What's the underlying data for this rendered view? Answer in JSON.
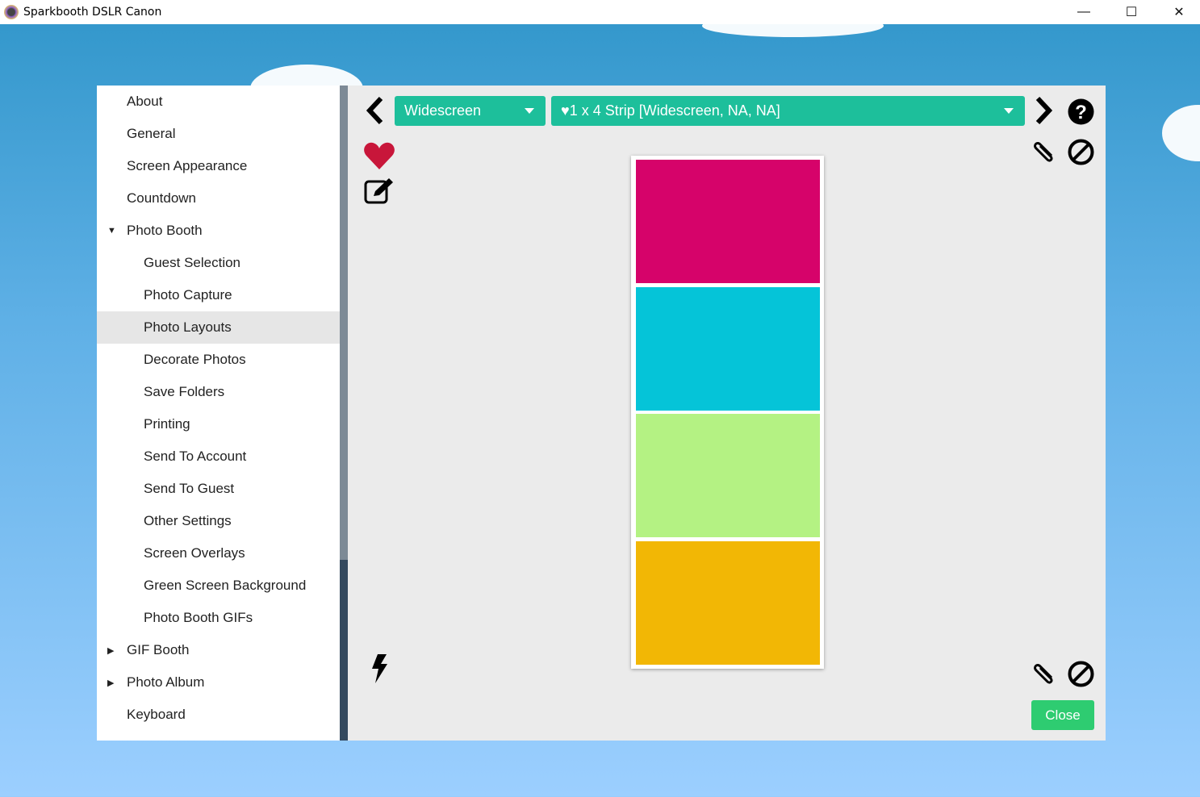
{
  "window": {
    "title": "Sparkbooth DSLR Canon",
    "minimize": "—",
    "maximize": "☐",
    "close": "✕"
  },
  "sidebar": {
    "items": [
      {
        "label": "About",
        "level": 1
      },
      {
        "label": "General",
        "level": 1
      },
      {
        "label": "Screen Appearance",
        "level": 1
      },
      {
        "label": "Countdown",
        "level": 1
      },
      {
        "label": "Photo Booth",
        "level": 1,
        "caret": "expanded"
      },
      {
        "label": "Guest Selection",
        "level": 2
      },
      {
        "label": "Photo Capture",
        "level": 2
      },
      {
        "label": "Photo Layouts",
        "level": 2,
        "selected": true
      },
      {
        "label": "Decorate Photos",
        "level": 2
      },
      {
        "label": "Save Folders",
        "level": 2
      },
      {
        "label": "Printing",
        "level": 2
      },
      {
        "label": "Send To Account",
        "level": 2
      },
      {
        "label": "Send To Guest",
        "level": 2
      },
      {
        "label": "Other Settings",
        "level": 2
      },
      {
        "label": "Screen Overlays",
        "level": 2
      },
      {
        "label": "Green Screen Background",
        "level": 2
      },
      {
        "label": "Photo Booth GIFs",
        "level": 2
      },
      {
        "label": "GIF Booth",
        "level": 1,
        "caret": "collapsed"
      },
      {
        "label": "Photo Album",
        "level": 1,
        "caret": "collapsed"
      },
      {
        "label": "Keyboard",
        "level": 1
      }
    ]
  },
  "main": {
    "format_select": "Widescreen",
    "layout_select": "♥1 x 4 Strip [Widescreen, NA, NA]",
    "close_label": "Close",
    "strip_colors": [
      "#d6036a",
      "#05c4d8",
      "#b4f283",
      "#f2b705"
    ],
    "accent": "#1dbf9b"
  }
}
